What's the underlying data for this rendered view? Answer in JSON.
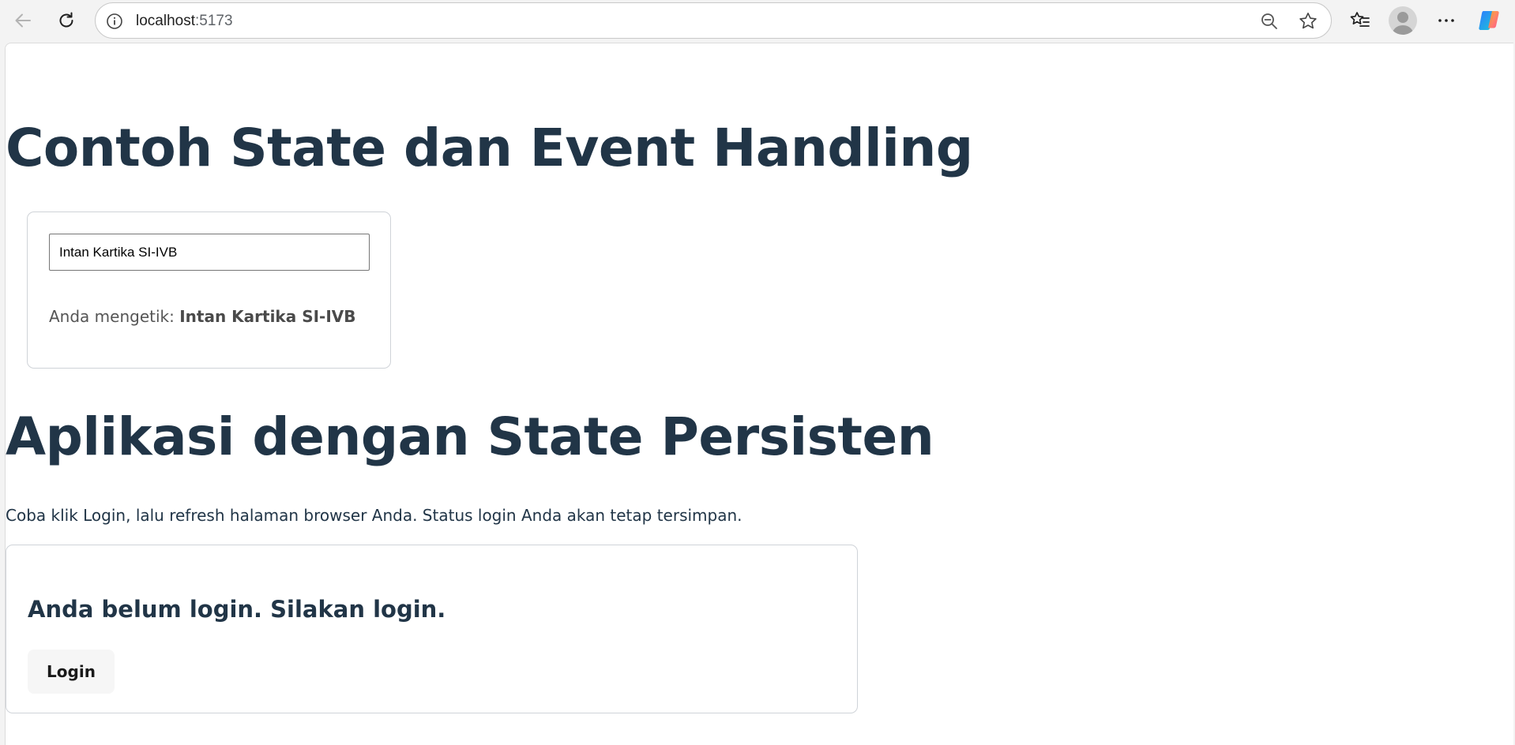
{
  "browser": {
    "url_host": "localhost",
    "url_port": ":5173",
    "icons": [
      "back-arrow-icon",
      "refresh-icon",
      "info-icon",
      "zoom-out-icon",
      "star-icon",
      "favorites-icon",
      "profile-avatar-icon",
      "more-icon",
      "copilot-icon"
    ]
  },
  "page": {
    "heading1": "Contoh State dan Event Handling",
    "input_value": "Intan Kartika SI-IVB",
    "typed_prefix": "Anda mengetik: ",
    "typed_value": "Intan Kartika SI-IVB",
    "heading2": "Aplikasi dengan State Persisten",
    "description": "Coba klik Login, lalu refresh halaman browser Anda. Status login Anda akan tetap tersimpan.",
    "login_status": "Anda belum login. Silakan login.",
    "login_button": "Login"
  },
  "colors": {
    "heading": "#213547",
    "card_border": "#cfd3d8",
    "button_bg": "#f6f6f6"
  }
}
